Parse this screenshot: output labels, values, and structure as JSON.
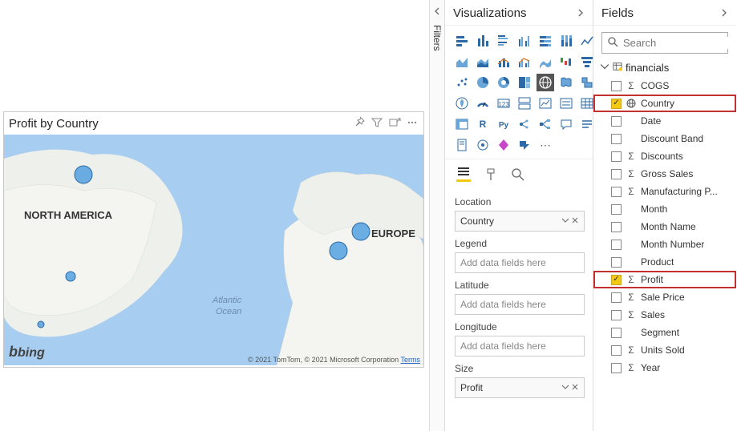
{
  "visual": {
    "title": "Profit by Country",
    "bing": "bing",
    "attrib_prefix": "© 2021 TomTom, © 2021 Microsoft Corporation ",
    "terms": "Terms"
  },
  "filters": {
    "label": "Filters"
  },
  "viz_pane": {
    "title": "Visualizations"
  },
  "wells": {
    "location": {
      "label": "Location",
      "value": "Country"
    },
    "legend": {
      "label": "Legend",
      "placeholder": "Add data fields here"
    },
    "latitude": {
      "label": "Latitude",
      "placeholder": "Add data fields here"
    },
    "longitude": {
      "label": "Longitude",
      "placeholder": "Add data fields here"
    },
    "size": {
      "label": "Size",
      "value": "Profit"
    }
  },
  "fields_pane": {
    "title": "Fields",
    "search_placeholder": "Search",
    "table": "financials",
    "items": [
      {
        "label": "COGS",
        "icon": "sigma"
      },
      {
        "label": "Country",
        "icon": "globe",
        "checked": true,
        "highlight": true
      },
      {
        "label": "Date",
        "icon": ""
      },
      {
        "label": "Discount Band",
        "icon": ""
      },
      {
        "label": "Discounts",
        "icon": "sigma"
      },
      {
        "label": "Gross Sales",
        "icon": "sigma"
      },
      {
        "label": "Manufacturing P...",
        "icon": "sigma"
      },
      {
        "label": "Month",
        "icon": ""
      },
      {
        "label": "Month Name",
        "icon": ""
      },
      {
        "label": "Month Number",
        "icon": ""
      },
      {
        "label": "Product",
        "icon": ""
      },
      {
        "label": "Profit",
        "icon": "sigma",
        "checked": true,
        "highlight": true
      },
      {
        "label": "Sale Price",
        "icon": "sigma"
      },
      {
        "label": "Sales",
        "icon": "sigma"
      },
      {
        "label": "Segment",
        "icon": ""
      },
      {
        "label": "Units Sold",
        "icon": "sigma"
      },
      {
        "label": "Year",
        "icon": "sigma"
      }
    ]
  },
  "map_labels": {
    "north_america": "NORTH AMERICA",
    "europe": "EUROPE",
    "atlantic1": "Atlantic",
    "atlantic2": "Ocean"
  }
}
